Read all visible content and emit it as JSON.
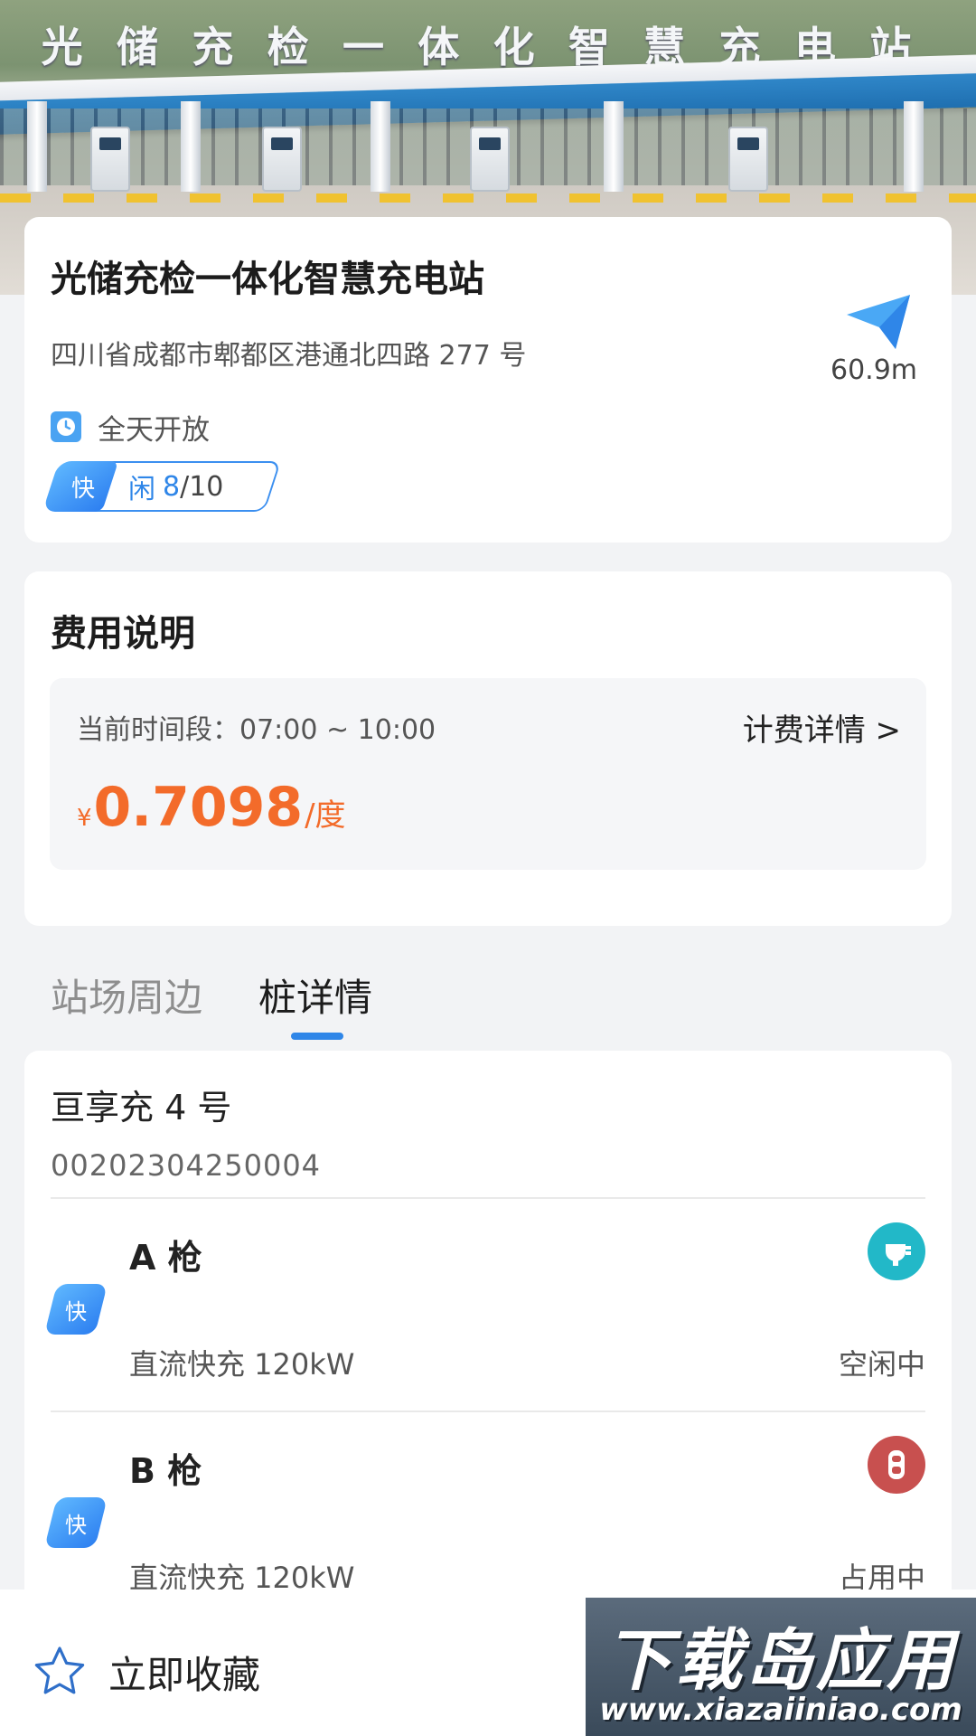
{
  "hero": {
    "sign_chars": [
      "光",
      "储",
      "充",
      "检",
      "一",
      "体",
      "化",
      "智",
      "慧",
      "充",
      "电",
      "站"
    ]
  },
  "station": {
    "name": "光储充检一体化智慧充电站",
    "address": "四川省成都市郫都区港通北四路 277 号",
    "distance": "60.9m",
    "hours": "全天开放",
    "gun_type_tag": "快",
    "idle_label": "闲",
    "idle_count": "8",
    "total_count": "/10"
  },
  "fee": {
    "title": "费用说明",
    "period": "当前时间段：07:00 ~ 10:00",
    "detail_link": "计费详情 >",
    "currency": "¥",
    "price": "0.7098",
    "unit": "/度"
  },
  "tabs": [
    {
      "label": "站场周边",
      "active": false
    },
    {
      "label": "桩详情",
      "active": true
    }
  ],
  "pile": {
    "name": "亘享充 4 号",
    "serial": "00202304250004",
    "guns": [
      {
        "tag": "快",
        "name": "A 枪",
        "spec": "直流快充 120kW",
        "status": "空闲中",
        "status_icon": "plug-icon",
        "status_color": "#22b8c8"
      },
      {
        "tag": "快",
        "name": "B 枪",
        "spec": "直流快充 120kW",
        "status": "占用中",
        "status_icon": "charging-icon",
        "status_color": "#c8504f"
      }
    ]
  },
  "bottom": {
    "favorite_label": "立即收藏",
    "watermark_title": "下载岛应用",
    "watermark_url": "www.xiazaiiniao.com"
  },
  "colors": {
    "accent": "#2f86e8",
    "price": "#f36b2a",
    "idle": "#22b8c8",
    "busy": "#c8504f"
  }
}
